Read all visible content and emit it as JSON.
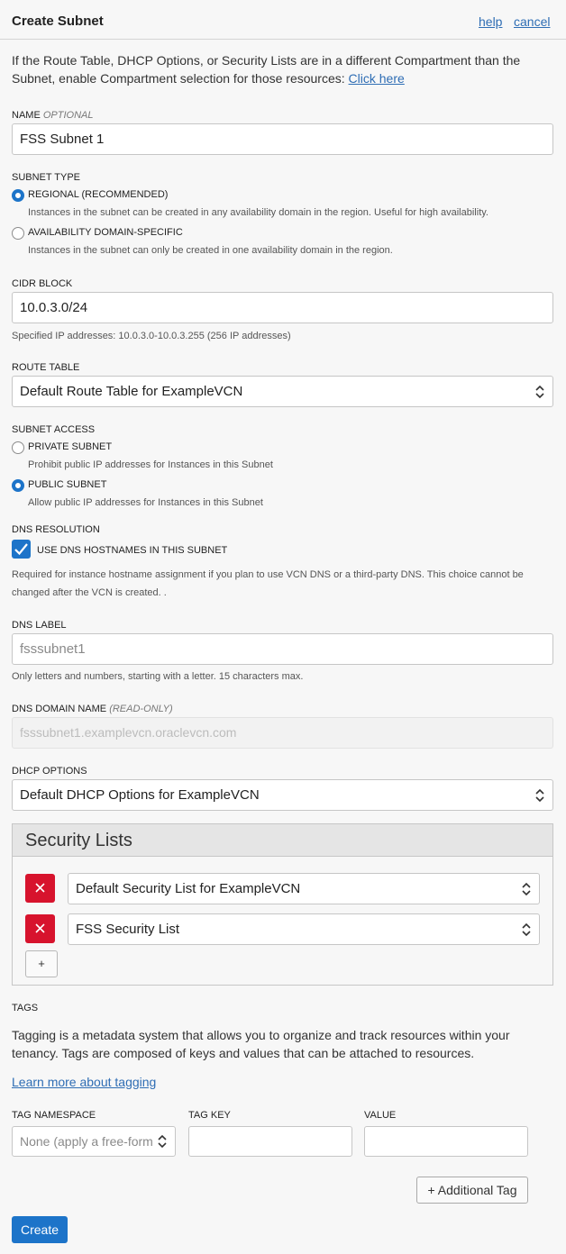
{
  "header": {
    "title": "Create Subnet",
    "help": "help",
    "cancel": "cancel"
  },
  "intro": {
    "text": "If the Route Table, DHCP Options, or Security Lists are in a different Compartment than the Subnet, enable Compartment selection for those resources: ",
    "link": "Click here"
  },
  "name": {
    "label": "NAME",
    "optional": "OPTIONAL",
    "value": "FSS Subnet 1"
  },
  "subnet_type": {
    "label": "SUBNET TYPE",
    "options": [
      {
        "label": "REGIONAL (RECOMMENDED)",
        "help": "Instances in the subnet can be created in any availability domain in the region. Useful for high availability.",
        "selected": true
      },
      {
        "label": "AVAILABILITY DOMAIN-SPECIFIC",
        "help": "Instances in the subnet can only be created in one availability domain in the region.",
        "selected": false
      }
    ]
  },
  "cidr": {
    "label": "CIDR BLOCK",
    "value": "10.0.3.0/24",
    "help": "Specified IP addresses: 10.0.3.0-10.0.3.255 (256 IP addresses)"
  },
  "route_table": {
    "label": "ROUTE TABLE",
    "value": "Default Route Table for ExampleVCN"
  },
  "subnet_access": {
    "label": "SUBNET ACCESS",
    "options": [
      {
        "label": "PRIVATE SUBNET",
        "help": "Prohibit public IP addresses for Instances in this Subnet",
        "selected": false
      },
      {
        "label": "PUBLIC SUBNET",
        "help": "Allow public IP addresses for Instances in this Subnet",
        "selected": true
      }
    ]
  },
  "dns_resolution": {
    "label": "DNS RESOLUTION",
    "checkbox_label": "USE DNS HOSTNAMES IN THIS SUBNET",
    "checked": true,
    "help": "Required for instance hostname assignment if you plan to use VCN DNS or a third-party DNS. This choice cannot be changed after the VCN is created. ."
  },
  "dns_label": {
    "label": "DNS LABEL",
    "placeholder": "fsssubnet1",
    "help": "Only letters and numbers, starting with a letter. 15 characters max."
  },
  "dns_domain": {
    "label": "DNS DOMAIN NAME",
    "readonly": "(READ-ONLY)",
    "value": "fsssubnet1.examplevcn.oraclevcn.com"
  },
  "dhcp": {
    "label": "DHCP OPTIONS",
    "value": "Default DHCP Options for ExampleVCN"
  },
  "security_lists": {
    "title": "Security Lists",
    "items": [
      "Default Security List for ExampleVCN",
      "FSS Security List"
    ],
    "add_label": "+"
  },
  "tags": {
    "label": "TAGS",
    "description": "Tagging is a metadata system that allows you to organize and track resources within your tenancy. Tags are composed of keys and values that can be attached to resources.",
    "learn_more": "Learn more about tagging",
    "namespace_label": "TAG NAMESPACE",
    "namespace_value": "None (apply a free-form",
    "key_label": "TAG KEY",
    "value_label": "VALUE",
    "additional": "+ Additional Tag"
  },
  "create": "Create",
  "colors": {
    "accent": "#1d74c9",
    "link": "#2e6db4",
    "danger": "#d7132d"
  }
}
